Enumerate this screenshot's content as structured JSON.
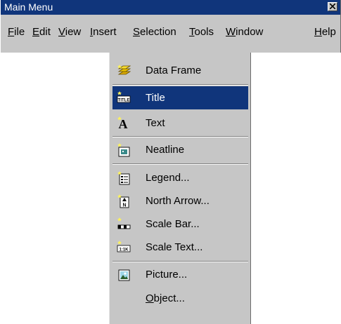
{
  "window": {
    "title": "Main Menu"
  },
  "menubar": [
    {
      "pre": "",
      "u": "F",
      "post": "ile"
    },
    {
      "pre": "",
      "u": "E",
      "post": "dit"
    },
    {
      "pre": "",
      "u": "V",
      "post": "iew"
    },
    {
      "pre": "",
      "u": "I",
      "post": "nsert"
    },
    {
      "pre": "",
      "u": "S",
      "post": "election"
    },
    {
      "pre": "",
      "u": "T",
      "post": "ools"
    },
    {
      "pre": "",
      "u": "W",
      "post": "indow"
    },
    {
      "pre": "",
      "u": "H",
      "post": "elp"
    }
  ],
  "insert_menu": {
    "items": [
      {
        "label": "Data Frame",
        "icon": "data-frame-icon"
      },
      {
        "label": "Title",
        "icon": "title-icon",
        "selected": true
      },
      {
        "label": "Text",
        "icon": "text-icon"
      },
      {
        "label": "Neatline",
        "icon": "neatline-icon"
      },
      {
        "label": "Legend...",
        "icon": "legend-icon"
      },
      {
        "label": "North Arrow...",
        "icon": "north-arrow-icon"
      },
      {
        "label": "Scale Bar...",
        "icon": "scale-bar-icon"
      },
      {
        "label": "Scale Text...",
        "icon": "scale-text-icon"
      },
      {
        "label": "Picture...",
        "icon": "picture-icon"
      },
      {
        "label_u": "O",
        "label_rest": "bject...",
        "icon": "object-icon"
      }
    ]
  },
  "colors": {
    "menu_bg": "#c6c6c6",
    "highlight": "#10357b",
    "title_bar": "#10357b"
  }
}
